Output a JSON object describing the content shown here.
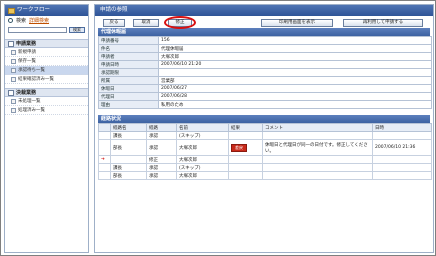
{
  "sidebar": {
    "title": "ワークフロー",
    "search_label": "検索",
    "advanced_search": "詳細検索",
    "search_button": "検索",
    "categories": [
      {
        "label": "申請業務",
        "items": [
          "新規申請",
          "保存一覧",
          "承認待ち一覧",
          "結果確認済み一覧"
        ]
      },
      {
        "label": "決裁業務",
        "items": [
          "未処理一覧",
          "処理済み一覧"
        ]
      }
    ]
  },
  "main": {
    "title": "申請の参照",
    "toolbar": {
      "back": "戻る",
      "cancel": "取消",
      "correct": "修正",
      "print": "印刷用画面を表示",
      "reapply": "再利用して申請する"
    },
    "proxy_section": {
      "heading": "代理休暇届",
      "rows": [
        {
          "key": "申請番号",
          "value": "156"
        },
        {
          "key": "件名",
          "value": "代理休暇届"
        },
        {
          "key": "申請者",
          "value": "大塚次郎"
        },
        {
          "key": "申請日時",
          "value": "2007/06/10 21:20"
        },
        {
          "key": "承認期限",
          "value": ""
        },
        {
          "key": "所属",
          "value": "営業部"
        },
        {
          "key": "休暇日",
          "value": "2007/06/27"
        },
        {
          "key": "代理日",
          "value": "2007/06/28"
        },
        {
          "key": "理由",
          "value": "私用のため"
        }
      ]
    },
    "route_section": {
      "heading": "経路状況",
      "columns": [
        "",
        "経路名",
        "経路",
        "名前",
        "結果",
        "コメント",
        "日時"
      ],
      "rows": [
        {
          "arrow": "",
          "role": "課長",
          "type": "承認",
          "name": "(スキップ)",
          "result": "",
          "comment": "",
          "date": ""
        },
        {
          "arrow": "",
          "role": "部長",
          "type": "承認",
          "name": "大塚次郎",
          "result": "差戻",
          "comment": "休暇日と代理日が同一の日付です。修正してください。",
          "date": "2007/06/10 21:36"
        },
        {
          "arrow": "➔",
          "role": "",
          "type": "修正",
          "name": "大塚次郎",
          "result": "",
          "comment": "",
          "date": ""
        },
        {
          "arrow": "",
          "role": "課長",
          "type": "承認",
          "name": "(スキップ)",
          "result": "",
          "comment": "",
          "date": ""
        },
        {
          "arrow": "",
          "role": "部長",
          "type": "承認",
          "name": "大塚次郎",
          "result": "",
          "comment": "",
          "date": ""
        }
      ]
    }
  }
}
